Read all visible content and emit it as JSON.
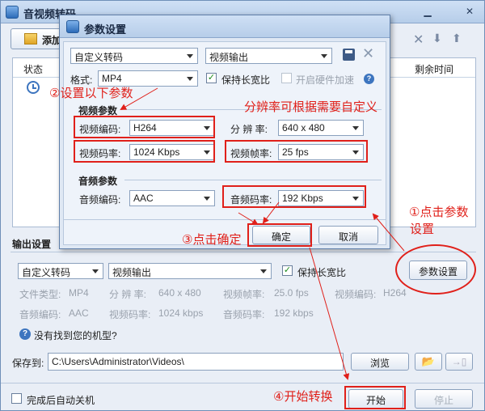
{
  "main": {
    "title": "音视频转码",
    "toolbar": {
      "add_label": "添加"
    },
    "list_headers": {
      "status": "状态",
      "remaining": "剩余时间"
    },
    "output_section": {
      "title": "输出设置",
      "preset": "自定义转码",
      "target": "视频输出",
      "keep_ratio_label": "保持长宽比",
      "keep_ratio_checked": true,
      "params_button": "参数设置",
      "info": {
        "file_type_label": "文件类型:",
        "file_type": "MP4",
        "resolution_label": "分 辨 率:",
        "resolution": "640 x 480",
        "fps_label": "视频帧率:",
        "fps": "25.0 fps",
        "vcodec_label": "视频编码:",
        "vcodec": "H264",
        "acodec_label": "音频编码:",
        "acodec": "AAC",
        "vbitrate_label": "视频码率:",
        "vbitrate": "1024 kbps",
        "abitrate_label": "音频码率:",
        "abitrate": "192 kbps"
      },
      "missing_model_label": "没有找到您的机型?"
    },
    "save": {
      "label": "保存到:",
      "path": "C:\\Users\\Administrator\\Videos\\",
      "browse_label": "浏览"
    },
    "bottom": {
      "auto_shutdown_label": "完成后自动关机",
      "start_label": "开始",
      "stop_label": "停止"
    }
  },
  "dialog": {
    "title": "参数设置",
    "preset": "自定义转码",
    "target": "视频输出",
    "format_label": "格式:",
    "format": "MP4",
    "keep_ratio_label": "保持长宽比",
    "hw_accel_label": "开启硬件加速",
    "video_section": "视频参数",
    "vcodec_label": "视频编码:",
    "vcodec": "H264",
    "resolution_label": "分 辨 率:",
    "resolution": "640 x 480",
    "vbitrate_label": "视频码率:",
    "vbitrate": "1024 Kbps",
    "fps_label": "视频帧率:",
    "fps": "25 fps",
    "audio_section": "音频参数",
    "acodec_label": "音频编码:",
    "acodec": "AAC",
    "abitrate_label": "音频码率:",
    "abitrate": "192 Kbps",
    "ok_label": "确定",
    "cancel_label": "取消"
  },
  "annotations": {
    "step1": "①点击参数",
    "step1b": "设置",
    "step2": "②设置以下参数",
    "step3": "③点击确定",
    "step4": "④开始转换",
    "resolution_note": "分辨率可根据需要自定义"
  },
  "colors": {
    "annotation": "#e0201a",
    "accent": "#2c6bb8"
  }
}
